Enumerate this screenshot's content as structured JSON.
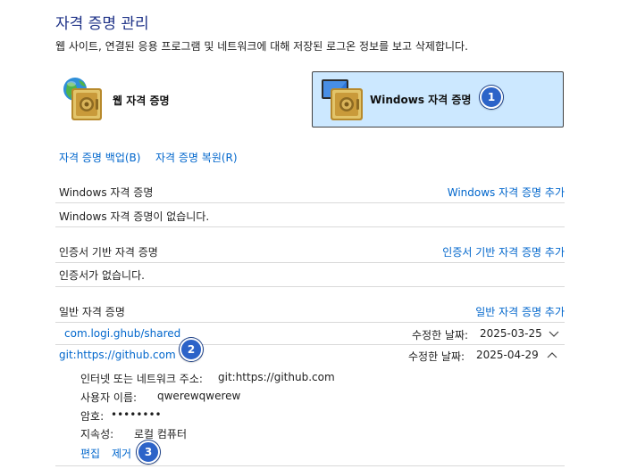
{
  "header": {
    "title": "자격 증명 관리",
    "subtitle": "웹 사이트, 연결된 응용 프로그램 및 네트워크에 대해 저장된 로그온 정보를 보고 삭제합니다."
  },
  "tiles": {
    "web": {
      "label": "웹 자격 증명"
    },
    "windows": {
      "label": "Windows 자격 증명",
      "selected": true
    }
  },
  "actions": {
    "backup": "자격 증명 백업(B)",
    "restore": "자격 증명 복원(R)"
  },
  "sections": {
    "windows": {
      "heading": "Windows 자격 증명",
      "add": "Windows 자격 증명 추가",
      "empty": "Windows 자격 증명이 없습니다."
    },
    "certificate": {
      "heading": "인증서 기반 자격 증명",
      "add": "인증서 기반 자격 증명 추가",
      "empty": "인증서가 없습니다."
    },
    "generic": {
      "heading": "일반 자격 증명",
      "add": "일반 자격 증명 추가",
      "items": [
        {
          "name": "com.logi.ghub/shared",
          "modified_label": "수정한 날짜:",
          "modified": "2025-03-25",
          "expanded": false
        },
        {
          "name": "git:https://github.com",
          "modified_label": "수정한 날짜:",
          "modified": "2025-04-29",
          "expanded": true
        }
      ],
      "details": {
        "address_label": "인터넷 또는 네트워크 주소:",
        "address": "git:https://github.com",
        "user_label": "사용자 이름:",
        "user": "qwerewqwerew",
        "password_label": "암호:",
        "password": "••••••••",
        "persistence_label": "지속성:",
        "persistence": "로컬 컴퓨터",
        "edit": "편집",
        "remove": "제거"
      }
    }
  },
  "badges": [
    "1",
    "2",
    "3"
  ],
  "colors": {
    "title": "#1e3287",
    "link": "#0066cc",
    "selected_tile_bg": "#cce8ff",
    "badge": "#2c63c8"
  },
  "icons": [
    "globe-vault-icon",
    "monitor-vault-icon",
    "chevron-down-icon",
    "chevron-up-icon"
  ]
}
